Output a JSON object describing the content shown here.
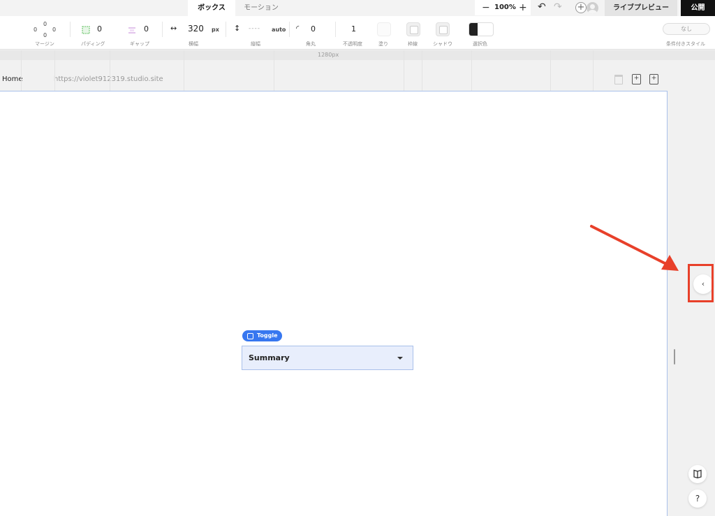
{
  "tabs": {
    "box": "ボックス",
    "motion": "モーション"
  },
  "header": {
    "zoom_out": "−",
    "zoom_level": "100%",
    "zoom_in": "+",
    "undo": "↶",
    "redo": "↷",
    "add": "+",
    "live_preview": "ライブプレビュー",
    "publish": "公開"
  },
  "toolbar": {
    "margin": {
      "label": "マージン",
      "top": "0",
      "left": "0",
      "right": "0",
      "bottom": "0"
    },
    "padding": {
      "label": "パディング",
      "value": "0"
    },
    "gap": {
      "label": "ギャップ",
      "value": "0"
    },
    "width": {
      "label": "横幅",
      "value": "320",
      "unit": "px",
      "icon": "↔"
    },
    "height": {
      "label": "縦幅",
      "value": "----",
      "unit": "auto",
      "icon": "↕"
    },
    "radius": {
      "label": "角丸",
      "value": "0",
      "icon": "◜"
    },
    "opacity": {
      "label": "不透明度",
      "value": "1"
    },
    "fill": {
      "label": "塗り"
    },
    "border": {
      "label": "枠線"
    },
    "shadow": {
      "label": "シャドウ"
    },
    "selection_color": {
      "label": "選択色"
    },
    "conditional_style": {
      "label": "条件付きスタイル",
      "value": "なし"
    }
  },
  "ruler": {
    "width_label": "1280px"
  },
  "page": {
    "name": "Home",
    "url": "https://violet912319.studio.site"
  },
  "canvas": {
    "toggle_badge": "Toggle",
    "summary": "Summary"
  },
  "right_panel": {
    "expand_icon": "‹",
    "help_label": "?",
    "book_icon": "book-icon"
  },
  "colors": {
    "accent": "#3777f0",
    "annotation": "#e8402a",
    "publish_bg": "#111111"
  }
}
